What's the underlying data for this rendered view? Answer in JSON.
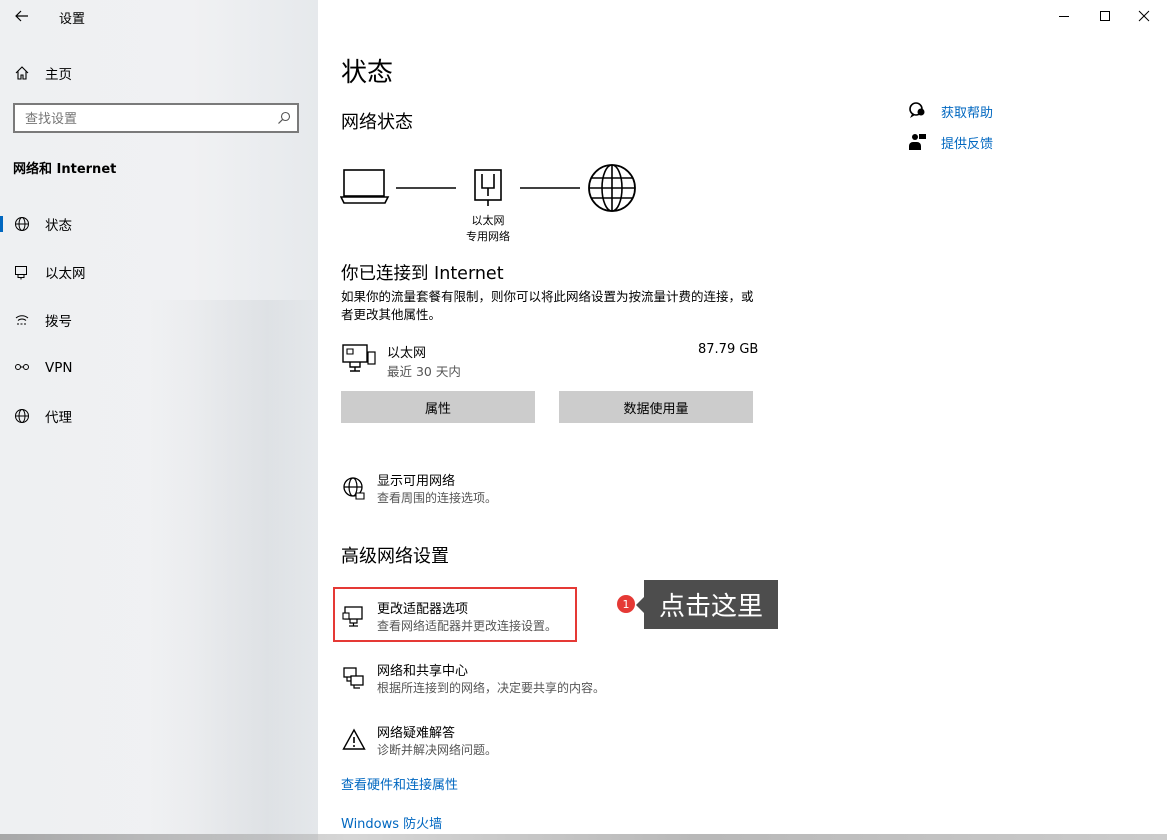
{
  "window": {
    "title": "设置",
    "controls": [
      "minimize",
      "maximize",
      "close"
    ]
  },
  "sidebar": {
    "home_label": "主页",
    "search_placeholder": "查找设置",
    "section_title": "网络和 Internet",
    "items": [
      {
        "label": "状态",
        "icon": "globe-status-icon",
        "active": true
      },
      {
        "label": "以太网",
        "icon": "ethernet-icon",
        "active": false
      },
      {
        "label": "拨号",
        "icon": "dialup-icon",
        "active": false
      },
      {
        "label": "VPN",
        "icon": "vpn-icon",
        "active": false
      },
      {
        "label": "代理",
        "icon": "globe-icon",
        "active": false
      }
    ]
  },
  "main": {
    "page_title": "状态",
    "network_status_title": "网络状态",
    "diagram_label_line1": "以太网",
    "diagram_label_line2": "专用网络",
    "connected_title": "你已连接到 Internet",
    "connected_desc": "如果你的流量套餐有限制，则你可以将此网络设置为按流量计费的连接，或者更改其他属性。",
    "adapter": {
      "name": "以太网",
      "period": "最近 30 天内",
      "usage": "87.79 GB"
    },
    "buttons": {
      "properties": "属性",
      "data_usage": "数据使用量"
    },
    "show_networks": {
      "title": "显示可用网络",
      "subtitle": "查看周围的连接选项。"
    },
    "advanced_title": "高级网络设置",
    "advanced_options": [
      {
        "title": "更改适配器选项",
        "subtitle": "查看网络适配器并更改连接设置。",
        "icon": "adapter-icon"
      },
      {
        "title": "网络和共享中心",
        "subtitle": "根据所连接到的网络，决定要共享的内容。",
        "icon": "sharing-center-icon"
      },
      {
        "title": "网络疑难解答",
        "subtitle": "诊断并解决网络问题。",
        "icon": "warning-icon"
      }
    ],
    "links": {
      "hardware": "查看硬件和连接属性",
      "firewall": "Windows 防火墙"
    }
  },
  "help": {
    "get_help": "获取帮助",
    "feedback": "提供反馈"
  },
  "annotation": {
    "number": "1",
    "text": "点击这里",
    "highlight_color": "#e53935"
  },
  "colors": {
    "accent": "#0067c0",
    "button_gray": "#cccccc"
  }
}
